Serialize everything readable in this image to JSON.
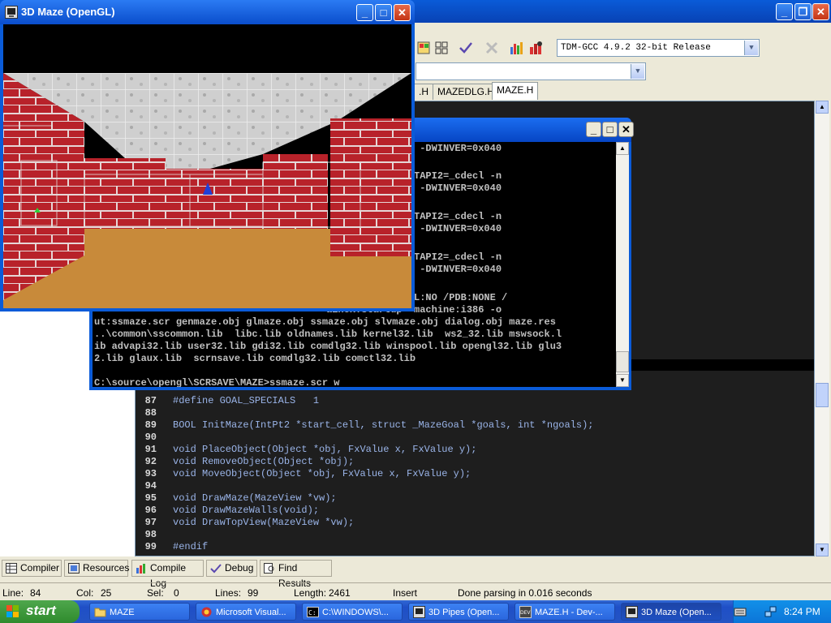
{
  "ide": {
    "compiler_combo": "TDM-GCC 4.9.2 32-bit Release",
    "tabs": [
      {
        "label": ".H",
        "active": false
      },
      {
        "label": "MAZEDLG.H",
        "active": false
      },
      {
        "label": "MAZE.H",
        "active": true
      }
    ],
    "code_lines": [
      {
        "num": "87",
        "text": "#define GOAL_SPECIALS   1"
      },
      {
        "num": "88",
        "text": ""
      },
      {
        "num": "89",
        "text": "BOOL InitMaze(IntPt2 *start_cell, struct _MazeGoal *goals, int *ngoals);"
      },
      {
        "num": "90",
        "text": ""
      },
      {
        "num": "91",
        "text": "void PlaceObject(Object *obj, FxValue x, FxValue y);"
      },
      {
        "num": "92",
        "text": "void RemoveObject(Object *obj);"
      },
      {
        "num": "93",
        "text": "void MoveObject(Object *obj, FxValue x, FxValue y);"
      },
      {
        "num": "94",
        "text": ""
      },
      {
        "num": "95",
        "text": "void DrawMaze(MazeView *vw);"
      },
      {
        "num": "96",
        "text": "void DrawMazeWalls(void);"
      },
      {
        "num": "97",
        "text": "void DrawTopView(MazeView *vw);"
      },
      {
        "num": "98",
        "text": ""
      },
      {
        "num": "99",
        "text": "#endif"
      }
    ],
    "bottom_tabs": [
      "Compiler",
      "Resources",
      "Compile Log",
      "Debug",
      "Find Results"
    ],
    "status": {
      "line_label": "Line:",
      "line_value": "84",
      "col_label": "Col:",
      "col_value": "25",
      "sel_label": "Sel:",
      "sel_value": "0",
      "lines_label": "Lines:",
      "lines_value": "99",
      "length_label": "Length:",
      "length_value": "2461",
      "mode": "Insert",
      "message": "Done parsing in 0.016 seconds"
    }
  },
  "cmd": {
    "lines": [
      "WIN32_IE=0x0300 -DWINVER=0x040",
      "",
      "PI1=_cdecl -DCRTAPI2=_cdecl -n",
      "WIN32_IE=0x0300 -DWINVER=0x040",
      "",
      "PI1=_cdecl -DCRTAPI2=_cdecl -n",
      "WIN32_IE=0x0300 -DWINVER=0x040",
      "",
      "PI1=_cdecl -DCRTAPI2=_cdecl -n",
      "WIN32_IE=0x0300 -DWINVER=0x040",
      "",
      "LIB /INCREMENTAL:NO /PDB:NONE /",
      "ainCRTStartup -machine:i386 -o",
      "ut:ssmaze.scr genmaze.obj glmaze.obj ssmaze.obj slvmaze.obj dialog.obj maze.res",
      "..\\common\\sscommon.lib  libc.lib oldnames.lib kernel32.lib  ws2_32.lib mswsock.l",
      "ib advapi32.lib user32.lib gdi32.lib comdlg32.lib winspool.lib opengl32.lib glu3",
      "2.lib glaux.lib  scrnsave.lib comdlg32.lib comctl32.lib",
      "",
      "C:\\source\\opengl\\SCRSAVE\\MAZE>ssmaze.scr w",
      "",
      "C:\\source\\opengl\\SCRSAVE\\MAZE>"
    ]
  },
  "maze": {
    "title": "3D Maze (OpenGL)"
  },
  "taskbar": {
    "start_label": "start",
    "tasks": [
      {
        "label": "MAZE",
        "active": false
      },
      {
        "label": "Microsoft Visual...",
        "active": false
      },
      {
        "label": "C:\\WINDOWS\\...",
        "active": false
      },
      {
        "label": "3D Pipes (Open...",
        "active": false
      },
      {
        "label": "MAZE.H - Dev-...",
        "active": false
      },
      {
        "label": "3D Maze (Open...",
        "active": true
      }
    ],
    "clock": "8:24 PM"
  },
  "colors": {
    "xp_blue": "#0a5bd8",
    "brick": "#b8222a",
    "floor": "#c88a3a"
  }
}
